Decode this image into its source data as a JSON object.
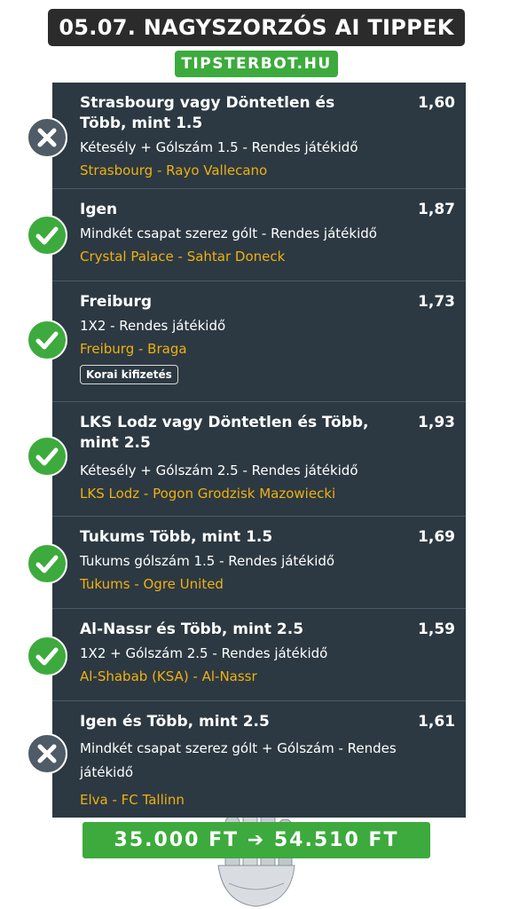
{
  "header": {
    "title": "05.07. NAGYSZORZÓS AI TIPPEK",
    "site": "TIPSTERBOT.HU"
  },
  "tips": [
    {
      "selection": "Strasbourg vagy Döntetlen és Több, mint 1.5",
      "odds": "1,60",
      "market": "Kétesély + Gólszám 1.5 - Rendes játékidő",
      "match": "Strasbourg - Rayo Vallecano",
      "result": "lost",
      "badge": ""
    },
    {
      "selection": "Igen",
      "odds": "1,87",
      "market": "Mindkét csapat szerez gólt - Rendes játékidő",
      "match": "Crystal Palace - Sahtar Doneck",
      "result": "won",
      "badge": ""
    },
    {
      "selection": "Freiburg",
      "odds": "1,73",
      "market": "1X2 - Rendes játékidő",
      "match": "Freiburg - Braga",
      "result": "won",
      "badge": "Korai kifizetés"
    },
    {
      "selection": "LKS Lodz vagy Döntetlen és Több, mint 2.5",
      "odds": "1,93",
      "market": "Kétesély + Gólszám 2.5 - Rendes játékidő",
      "match": "LKS Lodz - Pogon Grodzisk Mazowiecki",
      "result": "won",
      "badge": ""
    },
    {
      "selection": "Tukums Több, mint 1.5",
      "odds": "1,69",
      "market": "Tukums gólszám 1.5 - Rendes játékidő",
      "match": "Tukums - Ogre United",
      "result": "won",
      "badge": ""
    },
    {
      "selection": "Al-Nassr és Több, mint 2.5",
      "odds": "1,59",
      "market": "1X2 + Gólszám 2.5 - Rendes játékidő",
      "match": "Al-Shabab (KSA) - Al-Nassr",
      "result": "won",
      "badge": ""
    },
    {
      "selection": "Igen és Több, mint 2.5",
      "odds": "1,61",
      "market": "Mindkét csapat szerez gólt + Gólszám - Rendes játékidő",
      "match": "Elva - FC Tallinn",
      "result": "lost",
      "badge": ""
    }
  ],
  "footer": {
    "total": "35.000 FT ➔ 54.510 FT"
  },
  "colors": {
    "panel": "#2c3942",
    "won": "#3daa3d",
    "lost": "#4f5b66",
    "match_text": "#f0b010",
    "accent_green": "#3daa3d",
    "title_bg": "#2b2b2b"
  },
  "icons": {
    "won": "check-icon",
    "lost": "cross-icon"
  }
}
